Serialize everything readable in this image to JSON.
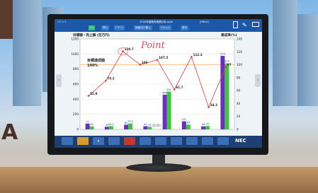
{
  "app": {
    "title": "2020年度販売実績分析.pptx",
    "window_badge": "[Office]",
    "vendor_logo": "NEC",
    "left_menu": "ﾃﾝﾌﾟﾚｰﾄ",
    "page_indicator": "2 / 5"
  },
  "tabs": [
    {
      "label": "ﾎｰﾑ"
    },
    {
      "label": "挿入"
    },
    {
      "label": "ﾃﾞｻﾞｲﾝ"
    },
    {
      "label": "画面切り替え"
    },
    {
      "label": "ｱﾆﾒｰｼｮﾝ"
    },
    {
      "label": "表示"
    }
  ],
  "toolbar_icons": [
    "file-icon",
    "pen-icon",
    "monitor-icon"
  ],
  "bottom_buttons": [
    "",
    "",
    "A",
    "",
    "",
    "",
    "",
    "",
    "",
    "",
    "",
    "",
    "",
    ""
  ],
  "chart_data": {
    "type": "bar",
    "title": "目標額・売上額 (百万円)",
    "subtitle_line1": "目標達成額",
    "subtitle_line2": "100%",
    "y2label": "達成率(%)",
    "ylim": [
      0,
      1200
    ],
    "y2lim": [
      0,
      140
    ],
    "yticks": [
      "1200",
      "1000",
      "800",
      "600",
      "400",
      "200",
      "0"
    ],
    "y2ticks": [
      "140",
      "120",
      "100",
      "80",
      "60",
      "40",
      "20",
      "0"
    ],
    "categories": [
      "",
      "",
      "",
      "",
      "",
      "",
      "",
      ""
    ],
    "series": [
      {
        "values": [
          77,
          35,
          62,
          42,
          460,
          107,
          40,
          974
        ]
      },
      {
        "values": [
          40,
          44,
          79,
          35,
          501,
          64,
          45,
          875
        ]
      }
    ],
    "bar_labels_a": [
      "77",
      "35",
      "62",
      "42",
      "469",
      "107",
      "46",
      "974"
    ],
    "bar_labels_b": [
      "40",
      "44.5",
      "79.5",
      "33",
      "501",
      "64",
      "47",
      "975"
    ],
    "line": {
      "values": [
        51.9,
        75.2,
        120.7,
        100,
        107.5,
        61.7,
        112.2,
        34.3,
        97
      ],
      "labels": [
        "51.9",
        "75.2",
        "120.7",
        "100",
        "107.5",
        "61.7",
        "112.2",
        "34.3",
        "97"
      ]
    },
    "target_line": 100,
    "annotation": "Point"
  }
}
